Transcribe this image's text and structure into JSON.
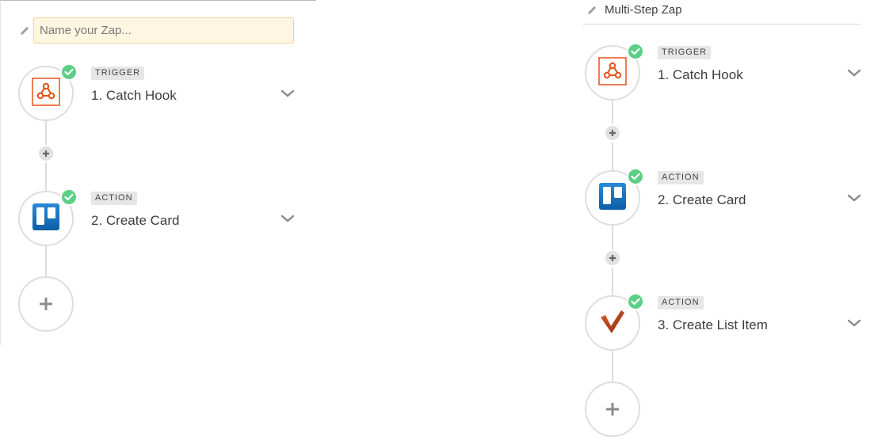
{
  "left_editor": {
    "name_input": {
      "value": "",
      "placeholder": "Name your Zap..."
    },
    "steps": [
      {
        "badge": "TRIGGER",
        "title": "1. Catch Hook",
        "app_icon": "webhook-icon",
        "status": "complete"
      },
      {
        "badge": "ACTION",
        "title": "2. Create Card",
        "app_icon": "trello-icon",
        "status": "complete"
      }
    ]
  },
  "right_editor": {
    "zap_title": "Multi-Step Zap",
    "steps": [
      {
        "badge": "TRIGGER",
        "title": "1. Catch Hook",
        "app_icon": "webhook-icon",
        "status": "complete"
      },
      {
        "badge": "ACTION",
        "title": "2. Create Card",
        "app_icon": "trello-icon",
        "status": "complete"
      },
      {
        "badge": "ACTION",
        "title": "3. Create List Item",
        "app_icon": "wunderlist-icon",
        "status": "complete"
      }
    ]
  },
  "colors": {
    "check": "#5ccf86",
    "webhook": "#e5521b",
    "trello": "#1f78c8",
    "wunderlist": "#b33b1c",
    "connector": "#dcdcdc"
  }
}
